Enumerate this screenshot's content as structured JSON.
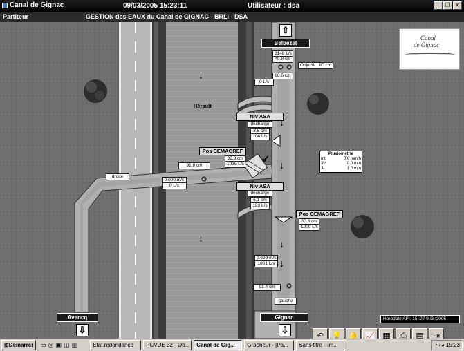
{
  "window": {
    "app_title": "Canal de Gignac",
    "datetime": "09/03/2005 15:23:11",
    "user": "Utilisateur : dsa"
  },
  "header": {
    "screen_name": "Partiteur",
    "title": "GESTION des EAUX du Canal de GIGNAC - BRLi - DSA"
  },
  "logo": {
    "line1": "Canal",
    "line2": "de Gignac"
  },
  "places": {
    "top": "Belbezet",
    "bottom_left": "Avencq",
    "bottom_right": "Gignac",
    "river": "Hérault"
  },
  "measures": {
    "belbezet_flow": "2148 L/s",
    "belbezet_level": "49.8 cm",
    "objective": "Objectif : 80 cm",
    "upper_level": "88.6 cm",
    "upper_flow": "0 L/s",
    "asa1_title": "Niv ASA",
    "asa1_mode": "décharge",
    "asa1_level": "3.8 cm",
    "asa1_flow": "104 L/s",
    "pos1_title": "Pos CEMAGREF",
    "pos1_pos": "32.3 cm",
    "pos1_flow": "1039 L/s",
    "left_level": "91.8 cm",
    "droite": "droite",
    "left_speed": "0.000 m/s",
    "left_flow": "0 L/s",
    "asa2_title": "Niv ASA",
    "asa2_mode": "décharge",
    "asa2_level": "6.1 cm",
    "asa2_flow": "183 L/s",
    "pos2_title": "Pos CEMAGREF",
    "pos2_pos": "30.3 cm",
    "pos2_flow": "1209 L/s",
    "lower_speed": "0.699 m/s",
    "lower_flow": "1861 L/s",
    "lower_level": "91.4 cm",
    "gauche": "gauche"
  },
  "pluviometrie": {
    "title": "Pluviometrie",
    "rows": [
      {
        "k": "Int.",
        "v": "0.0 mm/h"
      },
      {
        "k": "3h",
        "v": "0.0 mm"
      },
      {
        "k": "J-",
        "v": "1.0 mm"
      }
    ]
  },
  "horodate": "Horodate API: 15 :27  9 /3 /2005",
  "taskbar": {
    "start": "Démarrer",
    "tasks": [
      "Etat redondance",
      "PCVUE 32 - Ob...",
      "Canal de Gig...",
      "Grapheur - [Pa...",
      "Sans titre - Im..."
    ],
    "active_index": 2,
    "clock": "15:23"
  }
}
